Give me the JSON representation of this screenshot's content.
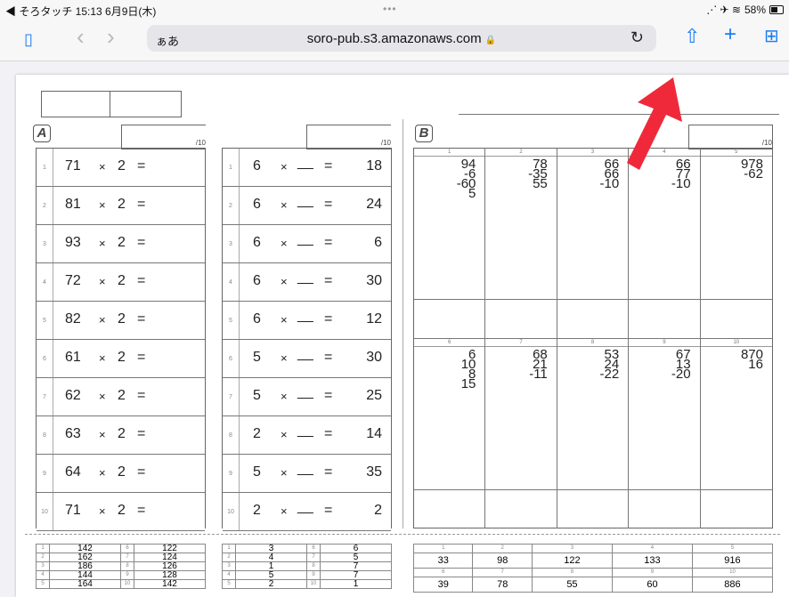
{
  "status_bar": {
    "left": "◀ そろタッチ  15:13  6月9日(木)",
    "center": "•••",
    "signal": "⋰ ✈ ≋",
    "battery": "58%"
  },
  "browser": {
    "text_size_label": "ぁあ",
    "url": "soro-pub.s3.amazonaws.com",
    "lock_icon": "🔒",
    "reload_icon": "↻",
    "share_icon": "⇧",
    "new_tab_icon": "+",
    "tabs_icon": "⊞",
    "sidebar_icon": "▯",
    "back_icon": "‹",
    "forward_icon": "›"
  },
  "worksheet": {
    "section_a": {
      "letter": "A",
      "score_denominator": "/10",
      "col1": [
        {
          "n": "1",
          "a": "71",
          "op": "×",
          "b": "2",
          "eq": "="
        },
        {
          "n": "2",
          "a": "81",
          "op": "×",
          "b": "2",
          "eq": "="
        },
        {
          "n": "3",
          "a": "93",
          "op": "×",
          "b": "2",
          "eq": "="
        },
        {
          "n": "4",
          "a": "72",
          "op": "×",
          "b": "2",
          "eq": "="
        },
        {
          "n": "5",
          "a": "82",
          "op": "×",
          "b": "2",
          "eq": "="
        },
        {
          "n": "6",
          "a": "61",
          "op": "×",
          "b": "2",
          "eq": "="
        },
        {
          "n": "7",
          "a": "62",
          "op": "×",
          "b": "2",
          "eq": "="
        },
        {
          "n": "8",
          "a": "63",
          "op": "×",
          "b": "2",
          "eq": "="
        },
        {
          "n": "9",
          "a": "64",
          "op": "×",
          "b": "2",
          "eq": "="
        },
        {
          "n": "10",
          "a": "71",
          "op": "×",
          "b": "2",
          "eq": "="
        }
      ],
      "col2": [
        {
          "n": "1",
          "a": "6",
          "op": "×",
          "blank": "__",
          "eq": "=",
          "r": "18"
        },
        {
          "n": "2",
          "a": "6",
          "op": "×",
          "blank": "__",
          "eq": "=",
          "r": "24"
        },
        {
          "n": "3",
          "a": "6",
          "op": "×",
          "blank": "__",
          "eq": "=",
          "r": "6"
        },
        {
          "n": "4",
          "a": "6",
          "op": "×",
          "blank": "__",
          "eq": "=",
          "r": "30"
        },
        {
          "n": "5",
          "a": "6",
          "op": "×",
          "blank": "__",
          "eq": "=",
          "r": "12"
        },
        {
          "n": "6",
          "a": "5",
          "op": "×",
          "blank": "__",
          "eq": "=",
          "r": "30"
        },
        {
          "n": "7",
          "a": "5",
          "op": "×",
          "blank": "__",
          "eq": "=",
          "r": "25"
        },
        {
          "n": "8",
          "a": "2",
          "op": "×",
          "blank": "__",
          "eq": "=",
          "r": "14"
        },
        {
          "n": "9",
          "a": "5",
          "op": "×",
          "blank": "__",
          "eq": "=",
          "r": "35"
        },
        {
          "n": "10",
          "a": "2",
          "op": "×",
          "blank": "__",
          "eq": "=",
          "r": "2"
        }
      ]
    },
    "section_b": {
      "letter": "B",
      "score_denominator": "/10",
      "top": [
        {
          "n": "1",
          "vals": [
            "94",
            "-6",
            "-60",
            "5"
          ]
        },
        {
          "n": "2",
          "vals": [
            "78",
            "-35",
            "55"
          ]
        },
        {
          "n": "3",
          "vals": [
            "66",
            "66",
            "-10"
          ]
        },
        {
          "n": "4",
          "vals": [
            "66",
            "77",
            "-10"
          ]
        },
        {
          "n": "5",
          "vals": [
            "978",
            "-62"
          ]
        }
      ],
      "bottom": [
        {
          "n": "6",
          "vals": [
            "6",
            "10",
            "8",
            "15"
          ]
        },
        {
          "n": "7",
          "vals": [
            "68",
            "21",
            "-11"
          ]
        },
        {
          "n": "8",
          "vals": [
            "53",
            "24",
            "-22"
          ]
        },
        {
          "n": "9",
          "vals": [
            "67",
            "13",
            "-20"
          ]
        },
        {
          "n": "10",
          "vals": [
            "870",
            "16"
          ]
        }
      ]
    },
    "answers": {
      "a1": [
        [
          "1",
          "142",
          "6",
          "122"
        ],
        [
          "2",
          "162",
          "7",
          "124"
        ],
        [
          "3",
          "186",
          "8",
          "126"
        ],
        [
          "4",
          "144",
          "9",
          "128"
        ],
        [
          "5",
          "164",
          "10",
          "142"
        ]
      ],
      "a2": [
        [
          "1",
          "3",
          "6",
          "6"
        ],
        [
          "2",
          "4",
          "7",
          "5"
        ],
        [
          "3",
          "1",
          "8",
          "7"
        ],
        [
          "4",
          "5",
          "9",
          "7"
        ],
        [
          "5",
          "2",
          "10",
          "1"
        ]
      ],
      "b_nums_top": [
        "1",
        "2",
        "3",
        "4",
        "5"
      ],
      "b_vals_top": [
        "33",
        "98",
        "122",
        "133",
        "916"
      ],
      "b_nums_bottom": [
        "6",
        "7",
        "8",
        "9",
        "10"
      ],
      "b_vals_bottom": [
        "39",
        "78",
        "55",
        "60",
        "886"
      ]
    }
  },
  "colors": {
    "accent": "#1a7cf5",
    "arrow": "#f0293a"
  }
}
